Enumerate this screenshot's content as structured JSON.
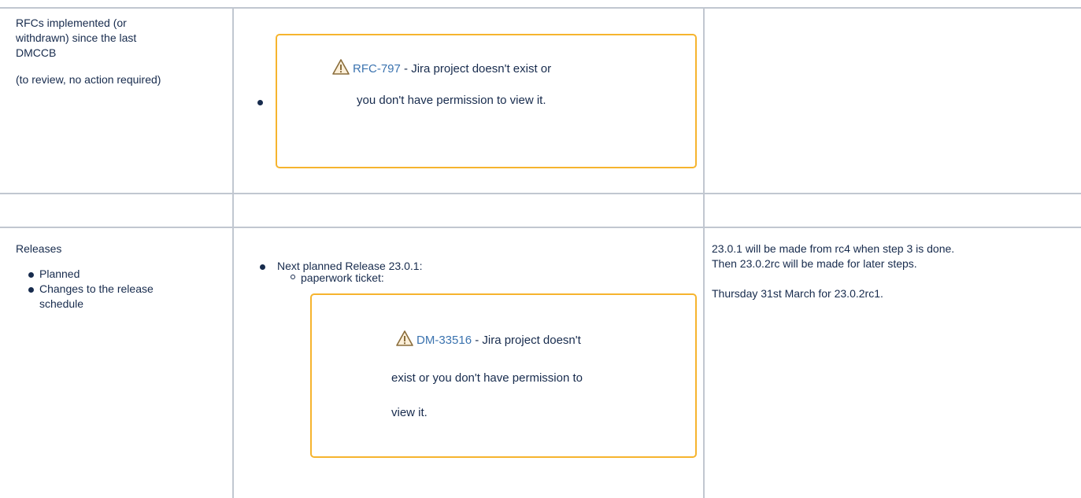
{
  "rows": [
    {
      "topic_lines": [
        "RFCs implemented (or",
        "withdrawn) since the last",
        "DMCCB"
      ],
      "topic_note": "(to review, no action required)",
      "jira_macro": {
        "link": "RFC-797",
        "message_line1": " - Jira project doesn't exist or",
        "message_line2": "you don't have permission to view it."
      },
      "notes": ""
    },
    {
      "topic": "",
      "details": "",
      "notes": ""
    },
    {
      "topic_title": "Releases",
      "topic_bullets": [
        "Planned",
        "Changes to the release",
        "schedule"
      ],
      "details_bullet": "Next planned Release 23.0.1:",
      "details_subbullet": "paperwork ticket:",
      "jira_macro": {
        "link": "DM-33516",
        "message_line1": " - Jira project doesn't",
        "message_line2": "exist or you don't have permission to",
        "message_line3": "view it."
      },
      "notes_lines": [
        "23.0.1 will be made from rc4 when step 3 is done.",
        "Then 23.0.2rc will be made for later steps.",
        "Thursday 31st March for 23.0.2rc1."
      ]
    }
  ],
  "icons": {
    "warning": "warning-icon"
  },
  "colors": {
    "link": "#3b73af",
    "macro_border": "#f6b42e",
    "grid": "#c1c7d0",
    "text": "#172b4d"
  }
}
